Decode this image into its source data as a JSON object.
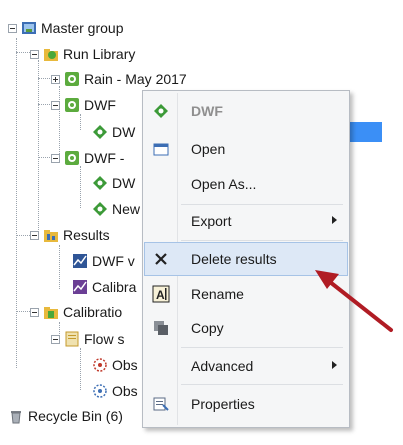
{
  "tree": {
    "master": "Master group",
    "run_library": "Run Library",
    "rain": "Rain - May 2017",
    "dwf1": "DWF",
    "dwf1_child": "DW",
    "dwf2": "DWF -",
    "dwf2_child1": "DW",
    "dwf2_child2": "New",
    "results": "Results",
    "dwf_v": "DWF v",
    "calibra": "Calibra",
    "calibratio": "Calibratio",
    "flow": "Flow s",
    "obs1": "Obs",
    "obs2": "Obs",
    "recycle": "Recycle Bin (6)"
  },
  "menu": {
    "header": "DWF",
    "open": "Open",
    "open_as": "Open As...",
    "export": "Export",
    "delete_results": "Delete results",
    "rename": "Rename",
    "copy": "Copy",
    "advanced": "Advanced",
    "properties": "Properties"
  },
  "colors": {
    "selection": "#3b8ff6",
    "menu_highlight": "#dde8f6",
    "annotation_arrow": "#b01c24"
  }
}
